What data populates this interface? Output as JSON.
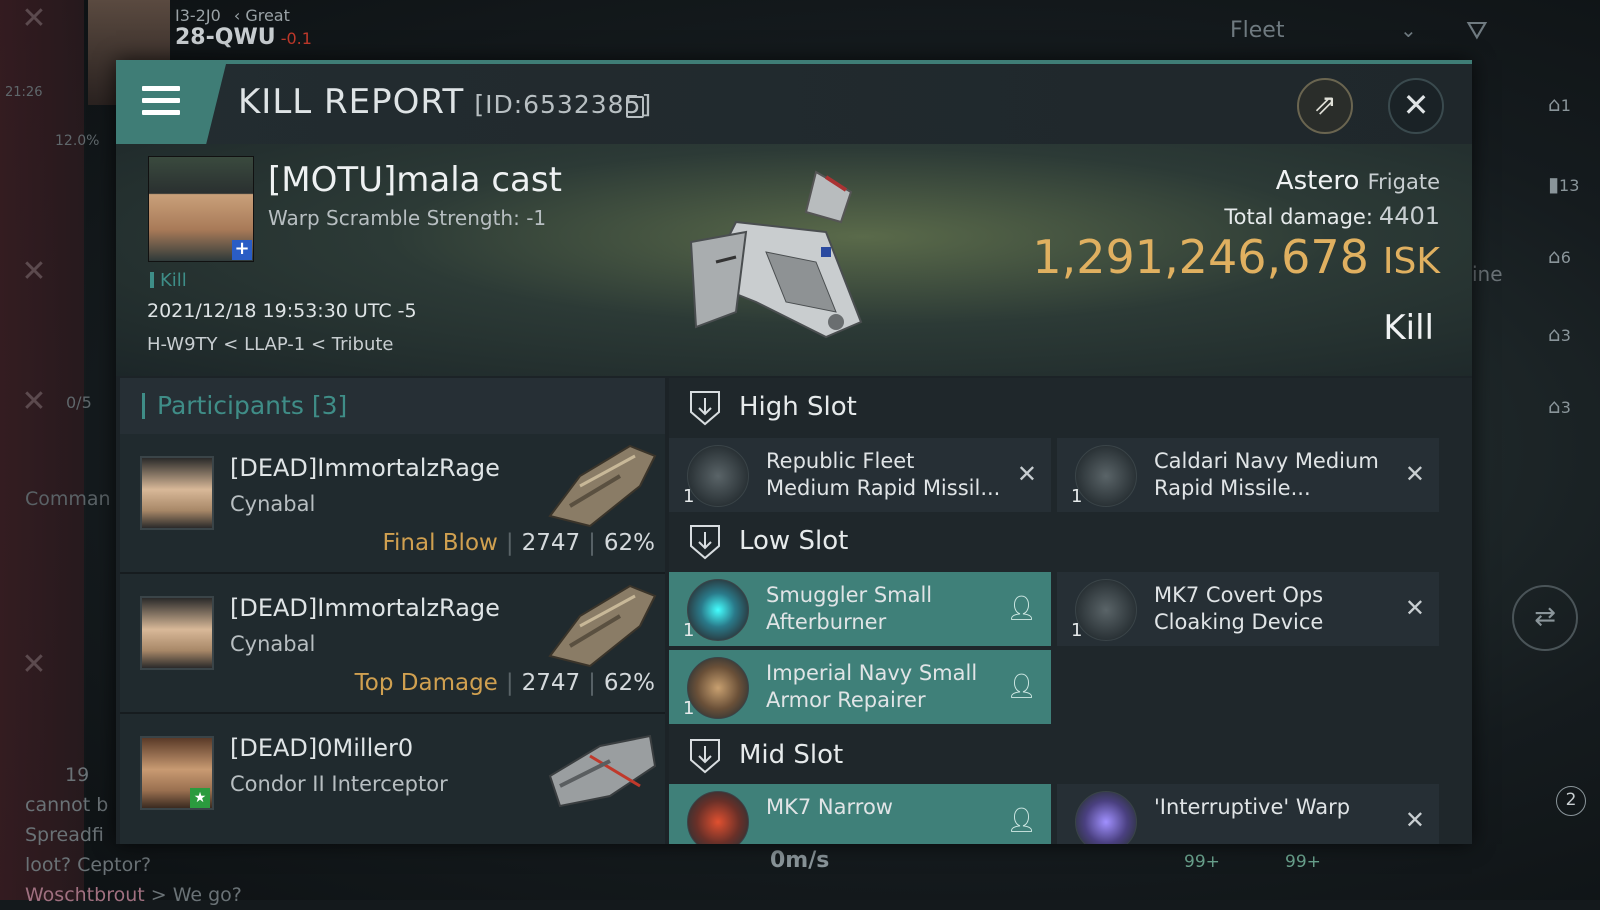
{
  "background": {
    "system_sec_line": "I3-2J0",
    "standing": "Great",
    "system": "28-QWU",
    "sec_status": "-0.1",
    "clock": "21:26",
    "percent": "12.0%",
    "fleet_label": "Fleet",
    "command_label": "Comman",
    "counter": "0/5",
    "right_counts": [
      "1",
      "13",
      "6",
      "3",
      "3"
    ],
    "right_text": "ine",
    "chat": {
      "count": "19",
      "lines": [
        "cannot b",
        "Spreadfi",
        "loot? Ceptor?"
      ],
      "last_name": "Woschtbrout",
      "last_msg": " > We go?"
    },
    "speed": "0m/s",
    "badges": [
      "99+",
      "99+"
    ],
    "drone_count": "2"
  },
  "report": {
    "title": "KILL REPORT",
    "id": "[ID:6532385]",
    "victim": {
      "name": "[MOTU]mala cast",
      "warp_scramble": "Warp Scramble Strength: -1",
      "tag": "Kill",
      "datetime": "2021/12/18 19:53:30 UTC -5",
      "location": "H-W9TY < LLAP-1 < Tribute"
    },
    "ship": {
      "name": "Astero",
      "class": "Frigate",
      "total_damage_label": "Total damage:",
      "total_damage": "4401",
      "isk_value": "1,291,246,678",
      "isk_unit": "ISK",
      "result": "Kill"
    },
    "participants": {
      "header": "Participants",
      "count": "[3]",
      "rows": [
        {
          "name": "[DEAD]ImmortalzRage",
          "ship": "Cynabal",
          "role": "Final Blow",
          "damage": "2747",
          "percent": "62%"
        },
        {
          "name": "[DEAD]ImmortalzRage",
          "ship": "Cynabal",
          "role": "Top Damage",
          "damage": "2747",
          "percent": "62%"
        },
        {
          "name": "[DEAD]0Miller0",
          "ship": "Condor II Interceptor",
          "role": "",
          "damage": "",
          "percent": ""
        }
      ]
    },
    "slots": {
      "high": {
        "label": "High Slot",
        "modules": [
          {
            "name": "Republic Fleet\nMedium Rapid Missil...",
            "qty": "1",
            "status": "destroyed"
          },
          {
            "name": "Caldari Navy Medium\nRapid Missile...",
            "qty": "1",
            "status": "destroyed"
          }
        ]
      },
      "low": {
        "label": "Low Slot",
        "modules": [
          {
            "name": "Smuggler Small\nAfterburner",
            "qty": "1",
            "status": "dropped"
          },
          {
            "name": "MK7 Covert Ops\nCloaking Device",
            "qty": "1",
            "status": "destroyed"
          },
          {
            "name": "Imperial Navy Small\nArmor Repairer",
            "qty": "1",
            "status": "dropped"
          }
        ]
      },
      "mid": {
        "label": "Mid Slot",
        "modules": [
          {
            "name": "MK7 Narrow",
            "qty": "",
            "status": "dropped"
          },
          {
            "name": "'Interruptive' Warp",
            "qty": "",
            "status": "destroyed"
          }
        ]
      }
    }
  },
  "colors": {
    "accent": "#3f7d76",
    "isk": "#e0b060",
    "role": "#d0a050"
  }
}
